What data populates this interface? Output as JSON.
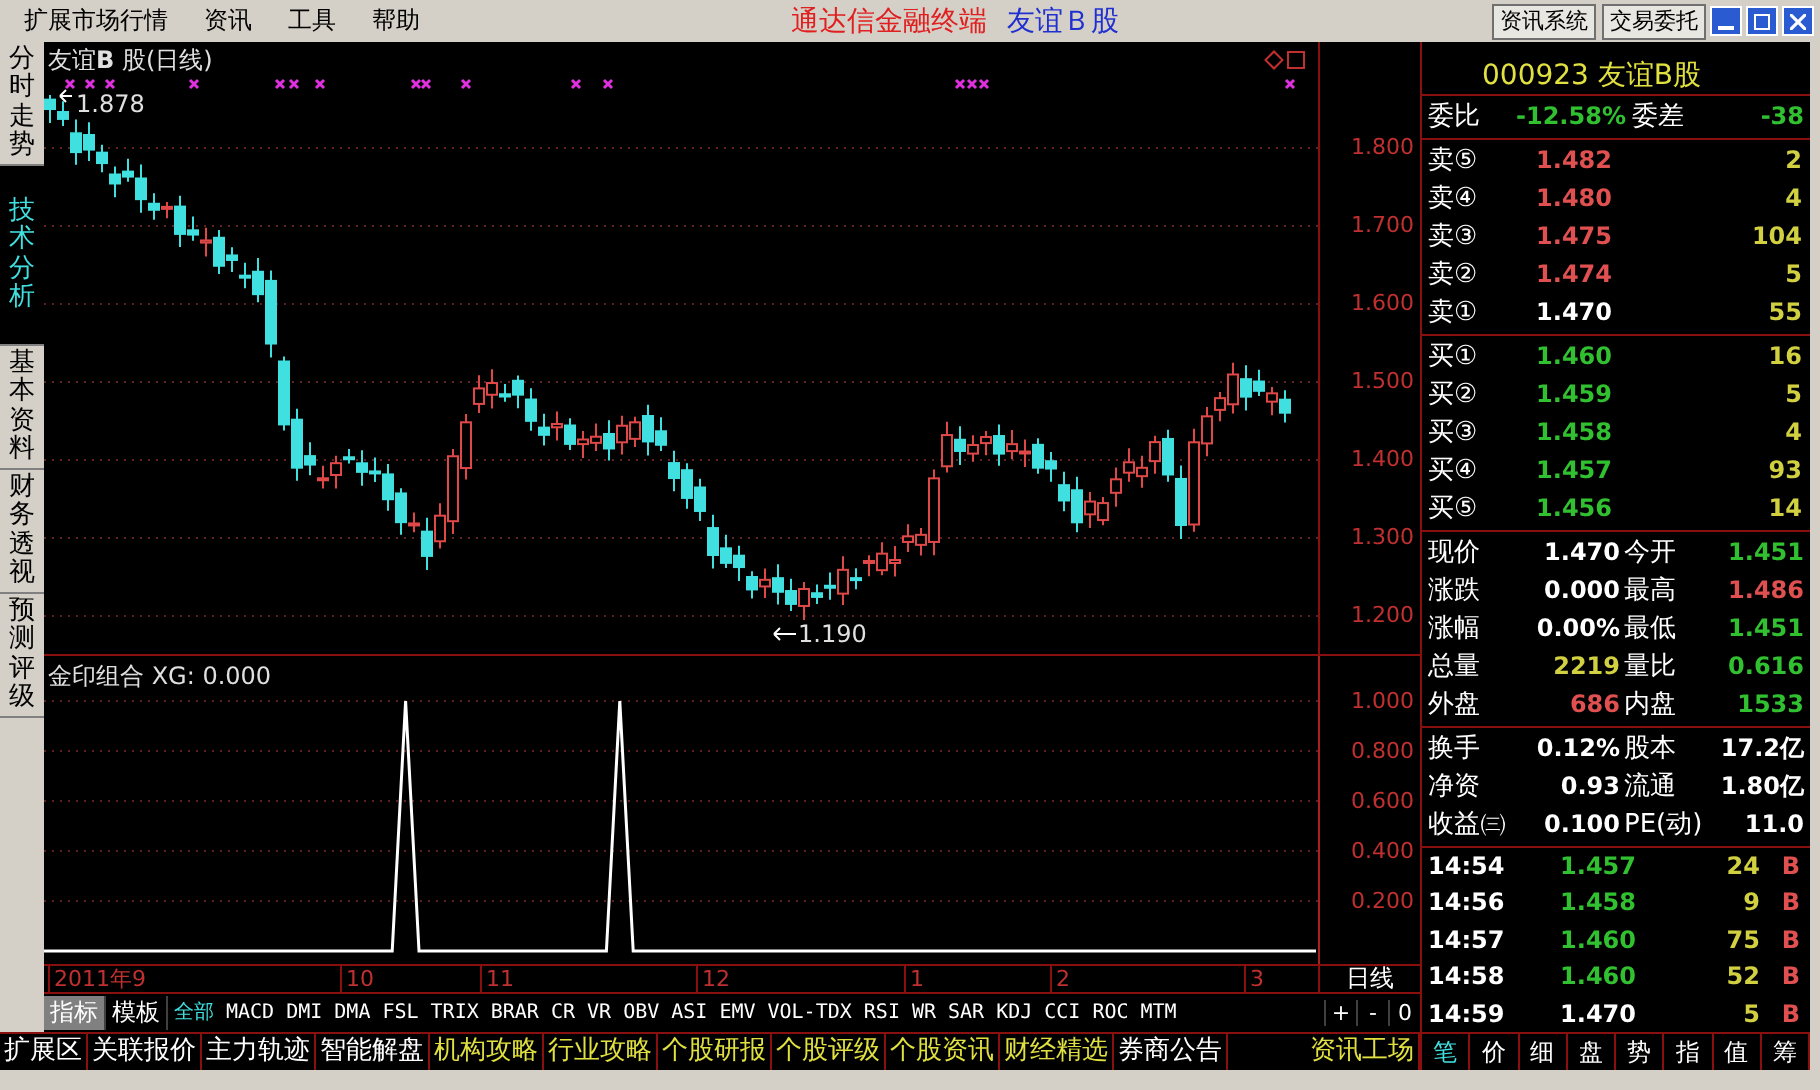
{
  "menu": {
    "items": [
      {
        "label": "扩展市场行情"
      },
      {
        "label": "资讯"
      },
      {
        "label": "工具"
      },
      {
        "label": "帮助"
      }
    ],
    "title": "通达信金融终端",
    "stock": "友谊Ｂ股",
    "buttons": [
      "资讯系统",
      "交易委托"
    ]
  },
  "side_tabs": [
    {
      "label": "分时走势",
      "selected": false
    },
    {
      "label": "技术分析",
      "selected": true
    },
    {
      "label": "基本资料",
      "selected": false
    },
    {
      "label": "财务透视",
      "selected": false
    },
    {
      "label": "预测评级",
      "selected": false
    }
  ],
  "chart": {
    "title": "友谊**B** 股(日线)",
    "high_label": "1.878",
    "low_label": "1.190",
    "price_ticks": [
      "1.800",
      "1.700",
      "1.600",
      "1.500",
      "1.400",
      "1.300",
      "1.200"
    ]
  },
  "indicator": {
    "title": "金印组合  XG: 0.000",
    "chart_data": {
      "type": "line",
      "grid": true,
      "ylim": [
        -0.052,
        1.18
      ],
      "yticks": [
        {
          "value": 1,
          "label": "1.000"
        },
        {
          "value": 0.8,
          "label": "0.800"
        },
        {
          "value": 0.6,
          "label": "0.600"
        },
        {
          "value": 0.4,
          "label": "0.400"
        },
        {
          "value": 0.2,
          "label": "0.200"
        }
      ],
      "series": [
        {
          "color": "#ffffff",
          "values": [
            0,
            0,
            0,
            0,
            0,
            0,
            0,
            0,
            0,
            0,
            0,
            0,
            0,
            0,
            0,
            0,
            0,
            0,
            0,
            0,
            0,
            0,
            0,
            0,
            0,
            0,
            0,
            1,
            0,
            0,
            0,
            0,
            0,
            0,
            0,
            0,
            0,
            0,
            0,
            0,
            0,
            0,
            0,
            1,
            0,
            0,
            0,
            0,
            0,
            0,
            0,
            0,
            0,
            0,
            0,
            0,
            0,
            0,
            0,
            0,
            0,
            0,
            0,
            0,
            0,
            0,
            0,
            0,
            0,
            0,
            0,
            0,
            0,
            0,
            0,
            0,
            0,
            0,
            0,
            0,
            0,
            0,
            0,
            0,
            0,
            0,
            0,
            0,
            0,
            0,
            0,
            0,
            0,
            0,
            0,
            0
          ]
        }
      ]
    }
  },
  "date_axis": {
    "labels": [
      "2011年9",
      "10",
      "11",
      "12",
      "1",
      "2",
      "3"
    ],
    "period": "日线"
  },
  "indicator_tabs": {
    "modes": [
      {
        "label": "指标",
        "selected": true
      },
      {
        "label": "模板",
        "selected": false
      }
    ],
    "items": [
      {
        "label": "全部",
        "selected": true
      },
      {
        "label": "MACD",
        "selected": false
      },
      {
        "label": "DMI",
        "selected": false
      },
      {
        "label": "DMA",
        "selected": false
      },
      {
        "label": "FSL",
        "selected": false
      },
      {
        "label": "TRIX",
        "selected": false
      },
      {
        "label": "BRAR",
        "selected": false
      },
      {
        "label": "CR",
        "selected": false
      },
      {
        "label": "VR",
        "selected": false
      },
      {
        "label": "OBV",
        "selected": false
      },
      {
        "label": "ASI",
        "selected": false
      },
      {
        "label": "EMV",
        "selected": false
      },
      {
        "label": "VOL-TDX",
        "selected": false
      },
      {
        "label": "RSI",
        "selected": false
      },
      {
        "label": "WR",
        "selected": false
      },
      {
        "label": "SAR",
        "selected": false
      },
      {
        "label": "KDJ",
        "selected": false
      },
      {
        "label": "CCI",
        "selected": false
      },
      {
        "label": "ROC",
        "selected": false
      },
      {
        "label": "MTM",
        "selected": false
      }
    ],
    "zoom": [
      "+",
      "-",
      "0"
    ]
  },
  "bottom_tabs": [
    {
      "label": "扩展区",
      "highlighted": false
    },
    {
      "label": "关联报价",
      "highlighted": false
    },
    {
      "label": "主力轨迹",
      "highlighted": false
    },
    {
      "label": "智能解盘",
      "highlighted": false
    },
    {
      "label": "机构攻略",
      "highlighted": true
    },
    {
      "label": "行业攻略",
      "highlighted": true
    },
    {
      "label": "个股研报",
      "highlighted": true
    },
    {
      "label": "个股评级",
      "highlighted": true
    },
    {
      "label": "个股资讯",
      "highlighted": true
    },
    {
      "label": "财经精选",
      "highlighted": true
    },
    {
      "label": "券商公告",
      "highlighted": false
    }
  ],
  "bottom_right": "资讯工场",
  "quote": {
    "title": "000923 友谊B股",
    "ratio_label": "委比",
    "ratio": "-12.58%",
    "diff_label": "委差",
    "diff": "-38",
    "asks": [
      {
        "label": "卖⑤",
        "price": "1.482",
        "color": "#e05050",
        "volume": "2"
      },
      {
        "label": "卖④",
        "price": "1.480",
        "color": "#e05050",
        "volume": "4"
      },
      {
        "label": "卖③",
        "price": "1.475",
        "color": "#e05050",
        "volume": "104"
      },
      {
        "label": "卖②",
        "price": "1.474",
        "color": "#e05050",
        "volume": "5"
      },
      {
        "label": "卖①",
        "price": "1.470",
        "color": "#ffffff",
        "volume": "55"
      }
    ],
    "bids": [
      {
        "label": "买①",
        "price": "1.460",
        "color": "#30c030",
        "volume": "16"
      },
      {
        "label": "买②",
        "price": "1.459",
        "color": "#30c030",
        "volume": "5"
      },
      {
        "label": "买③",
        "price": "1.458",
        "color": "#30c030",
        "volume": "4"
      },
      {
        "label": "买④",
        "price": "1.457",
        "color": "#30c030",
        "volume": "93"
      },
      {
        "label": "买⑤",
        "price": "1.456",
        "color": "#30c030",
        "volume": "14"
      }
    ],
    "stats": [
      {
        "cells": [
          {
            "label": "现价",
            "value": "1.470",
            "color": "#ffffff"
          },
          {
            "label": "今开",
            "value": "1.451",
            "color": "#30c030"
          }
        ]
      },
      {
        "cells": [
          {
            "label": "涨跌",
            "value": "0.000",
            "color": "#ffffff"
          },
          {
            "label": "最高",
            "value": "1.486",
            "color": "#e05050"
          }
        ]
      },
      {
        "cells": [
          {
            "label": "涨幅",
            "value": "0.00%",
            "color": "#ffffff"
          },
          {
            "label": "最低",
            "value": "1.451",
            "color": "#30c030"
          }
        ]
      },
      {
        "cells": [
          {
            "label": "总量",
            "value": "2219",
            "color": "#d0d040"
          },
          {
            "label": "量比",
            "value": "0.616",
            "color": "#30c030"
          }
        ]
      },
      {
        "cells": [
          {
            "label": "外盘",
            "value": "686",
            "color": "#e05050"
          },
          {
            "label": "内盘",
            "value": "1533",
            "color": "#30c030"
          }
        ]
      }
    ],
    "fundamentals": [
      {
        "label": "换手",
        "value": "0.12%",
        "label2": "股本",
        "value2": "17.2亿"
      },
      {
        "label": "净资",
        "value": "0.93",
        "label2": "流通",
        "value2": "1.80亿"
      },
      {
        "label": "收益㈢",
        "value": "0.100",
        "label2": "PE(动)",
        "value2": "11.0"
      }
    ],
    "trades": [
      {
        "time": "14:54",
        "price": "1.457",
        "color": "#30c030",
        "volume": "24",
        "side": "B"
      },
      {
        "time": "14:56",
        "price": "1.458",
        "color": "#30c030",
        "volume": "9",
        "side": "B"
      },
      {
        "time": "14:57",
        "price": "1.460",
        "color": "#30c030",
        "volume": "75",
        "side": "B"
      },
      {
        "time": "14:58",
        "price": "1.460",
        "color": "#30c030",
        "volume": "52",
        "side": "B"
      },
      {
        "time": "14:59",
        "price": "1.470",
        "color": "#ffffff",
        "volume": "5",
        "side": "B"
      }
    ],
    "tabs": [
      {
        "label": "笔",
        "selected": true
      },
      {
        "label": "价",
        "selected": false
      },
      {
        "label": "细",
        "selected": false
      },
      {
        "label": "盘",
        "selected": false
      },
      {
        "label": "势",
        "selected": false
      },
      {
        "label": "指",
        "selected": false
      },
      {
        "label": "值",
        "selected": false
      },
      {
        "label": "筹",
        "selected": false
      }
    ]
  }
}
